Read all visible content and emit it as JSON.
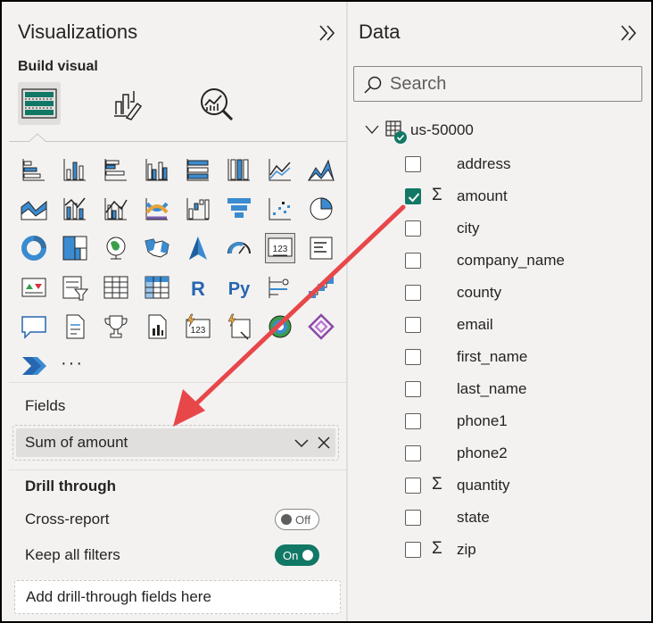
{
  "visualizations": {
    "title": "Visualizations",
    "collapse_icon": "double-chevron-right-icon",
    "build_visual_label": "Build visual",
    "tabs": [
      {
        "icon": "build-visual-icon",
        "selected": true
      },
      {
        "icon": "format-visual-icon",
        "selected": false
      },
      {
        "icon": "analytics-icon",
        "selected": false
      }
    ],
    "more_label": "···",
    "fields_label": "Fields",
    "field_pill": "Sum of amount",
    "drill_through_label": "Drill through",
    "cross_report": {
      "label": "Cross-report",
      "state": "Off"
    },
    "keep_filters": {
      "label": "Keep all filters",
      "state": "On"
    },
    "add_drill_placeholder": "Add drill-through fields here"
  },
  "data": {
    "title": "Data",
    "collapse_icon": "double-chevron-right-icon",
    "search_placeholder": "Search",
    "table_name": "us-50000",
    "fields": [
      {
        "name": "address",
        "sigma": false,
        "checked": false
      },
      {
        "name": "amount",
        "sigma": true,
        "checked": true
      },
      {
        "name": "city",
        "sigma": false,
        "checked": false
      },
      {
        "name": "company_name",
        "sigma": false,
        "checked": false
      },
      {
        "name": "county",
        "sigma": false,
        "checked": false
      },
      {
        "name": "email",
        "sigma": false,
        "checked": false
      },
      {
        "name": "first_name",
        "sigma": false,
        "checked": false
      },
      {
        "name": "last_name",
        "sigma": false,
        "checked": false
      },
      {
        "name": "phone1",
        "sigma": false,
        "checked": false
      },
      {
        "name": "phone2",
        "sigma": false,
        "checked": false
      },
      {
        "name": "quantity",
        "sigma": true,
        "checked": false
      },
      {
        "name": "state",
        "sigma": false,
        "checked": false
      },
      {
        "name": "zip",
        "sigma": true,
        "checked": false
      }
    ]
  },
  "colors": {
    "accent": "#117865",
    "panel": "#f3f2f1",
    "arrow": "#e8474a",
    "icon_blue": "#3b8bd0",
    "icon_dark": "#252423"
  }
}
